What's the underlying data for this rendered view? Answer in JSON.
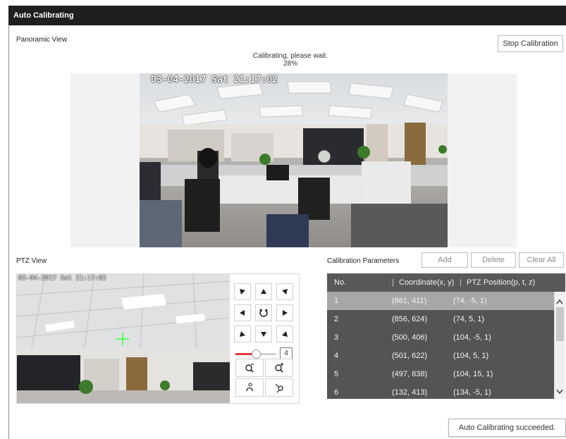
{
  "window": {
    "title": "Auto Calibrating"
  },
  "panoramic": {
    "label": "Panoramic View",
    "stop_button": "Stop Calibration",
    "status_text": "Calibrating, please wait.",
    "progress": "28%",
    "osd": "03-04-2017 Sat 21:17:02"
  },
  "ptz": {
    "label": "PTZ View",
    "osd": "03-04-2017 Sat 21:17:02",
    "zoom_value": "4",
    "icons": [
      "arrow-up-left-icon",
      "arrow-up-icon",
      "arrow-up-right-icon",
      "arrow-left-icon",
      "auto-rotate-icon",
      "arrow-right-icon",
      "arrow-down-left-icon",
      "arrow-down-icon",
      "arrow-down-right-icon",
      "zoom-out-icon",
      "zoom-in-icon",
      "focus-near-icon",
      "focus-far-icon"
    ]
  },
  "calibration": {
    "label": "Calibration Parameters",
    "add": "Add",
    "delete": "Delete",
    "clear_all": "Clear All",
    "columns": [
      "No.",
      "Coordinate(x, y)",
      "PTZ Position(p, t, z)"
    ],
    "rows": [
      [
        "1",
        "(861, 411)",
        "(74, -5, 1)"
      ],
      [
        "2",
        "(856, 624)",
        "(74, 5, 1)"
      ],
      [
        "3",
        "(500, 406)",
        "(104, -5, 1)"
      ],
      [
        "4",
        "(501, 622)",
        "(104, 5, 1)"
      ],
      [
        "5",
        "(497, 838)",
        "(104, 15, 1)"
      ],
      [
        "6",
        "(132, 413)",
        "(134, -5, 1)"
      ]
    ],
    "selected_row": 0
  },
  "toast": {
    "text": "Auto Calibrating succeeded."
  },
  "colors": {
    "titlebar": "#1f1f1f",
    "table_row": "#545454",
    "table_selected": "#a7a7a7",
    "slider": "#e23a3a",
    "crosshair": "#5cff5c"
  }
}
